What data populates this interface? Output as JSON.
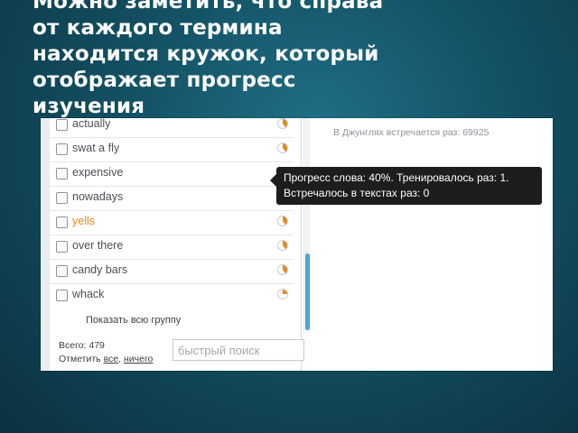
{
  "slide": {
    "title_lines": [
      "Можно заметить, что справа",
      "от каждого термина",
      "находится кружок, который",
      "отображает прогресс",
      "изучения"
    ]
  },
  "word_list": {
    "items": [
      {
        "word": "actually",
        "progress": 0.4,
        "highlight": false
      },
      {
        "word": "swat a fly",
        "progress": 0.4,
        "highlight": false
      },
      {
        "word": "expensive",
        "progress": 0.4,
        "highlight": false
      },
      {
        "word": "nowadays",
        "progress": 0.4,
        "highlight": false
      },
      {
        "word": "yells",
        "progress": 0.4,
        "highlight": true
      },
      {
        "word": "over there",
        "progress": 0.4,
        "highlight": false
      },
      {
        "word": "candy bars",
        "progress": 0.4,
        "highlight": false
      },
      {
        "word": "whack",
        "progress": 0.25,
        "highlight": false
      }
    ],
    "show_group_label": "Показать всю группу",
    "total_label": "Всего: 479",
    "mark_label": "Отметить",
    "mark_all": "все",
    "mark_none": "ничего",
    "search_placeholder": "быстрый поиск"
  },
  "info": {
    "jungle_count": "В Джунглях встречается раз: 69925"
  },
  "tooltip": {
    "line1": "Прогресс слова: 40%. Тренировалось раз: 1.",
    "line2": "Встречалось в текстах раз: 0"
  },
  "colors": {
    "progress_fill": "#e8891e",
    "highlight_word": "#e8891e",
    "scrollbar": "#4ea6d4"
  }
}
